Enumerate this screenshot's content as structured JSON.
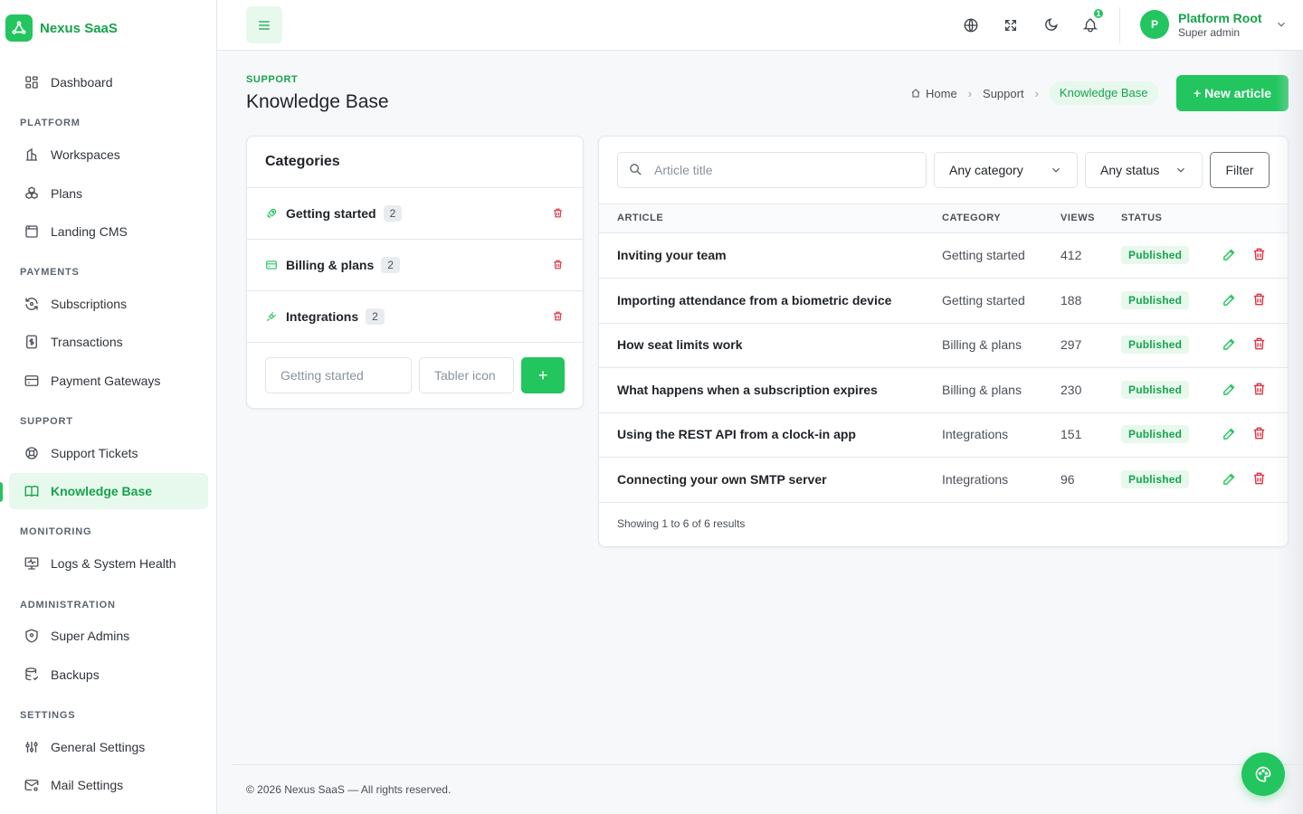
{
  "brand": {
    "name": "Nexus SaaS"
  },
  "sidebar": {
    "dashboard": "Dashboard",
    "sections": {
      "platform": "PLATFORM",
      "payments": "PAYMENTS",
      "support": "SUPPORT",
      "monitoring": "MONITORING",
      "administration": "ADMINISTRATION",
      "settings": "SETTINGS"
    },
    "items": {
      "workspaces": "Workspaces",
      "plans": "Plans",
      "landing_cms": "Landing CMS",
      "subscriptions": "Subscriptions",
      "transactions": "Transactions",
      "payment_gateways": "Payment Gateways",
      "support_tickets": "Support Tickets",
      "knowledge_base": "Knowledge Base",
      "logs": "Logs & System Health",
      "super_admins": "Super Admins",
      "backups": "Backups",
      "general_settings": "General Settings",
      "mail_settings": "Mail Settings"
    },
    "active": "knowledge_base"
  },
  "topbar": {
    "icons": [
      "menu-icon",
      "globe-icon",
      "fullscreen-icon",
      "moon-icon",
      "bell-icon"
    ],
    "notification_count": "1",
    "user": {
      "initial": "P",
      "name": "Platform Root",
      "role": "Super admin"
    }
  },
  "page": {
    "pretitle": "SUPPORT",
    "title": "Knowledge Base",
    "breadcrumb": {
      "home": "Home",
      "support": "Support",
      "current": "Knowledge Base"
    },
    "new_button": "+ New article"
  },
  "categories": {
    "title": "Categories",
    "items": [
      {
        "name": "Getting started",
        "count": "2",
        "icon": "rocket-icon"
      },
      {
        "name": "Billing & plans",
        "count": "2",
        "icon": "credit-card-icon"
      },
      {
        "name": "Integrations",
        "count": "2",
        "icon": "plug-icon"
      }
    ],
    "form": {
      "name_placeholder": "Getting started",
      "icon_placeholder": "Tabler icon",
      "add_label": "+"
    }
  },
  "articles": {
    "search_placeholder": "Article title",
    "category_filter": "Any category",
    "status_filter": "Any status",
    "filter_button": "Filter",
    "columns": {
      "article": "ARTICLE",
      "category": "CATEGORY",
      "views": "VIEWS",
      "status": "STATUS"
    },
    "rows": [
      {
        "title": "Inviting your team",
        "category": "Getting started",
        "views": "412",
        "status": "Published"
      },
      {
        "title": "Importing attendance from a biometric device",
        "category": "Getting started",
        "views": "188",
        "status": "Published"
      },
      {
        "title": "How seat limits work",
        "category": "Billing & plans",
        "views": "297",
        "status": "Published"
      },
      {
        "title": "What happens when a subscription expires",
        "category": "Billing & plans",
        "views": "230",
        "status": "Published"
      },
      {
        "title": "Using the REST API from a clock-in app",
        "category": "Integrations",
        "views": "151",
        "status": "Published"
      },
      {
        "title": "Connecting your own SMTP server",
        "category": "Integrations",
        "views": "96",
        "status": "Published"
      }
    ],
    "summary": "Showing 1 to 6 of 6 results"
  },
  "footer": {
    "text": "© 2026 Nexus SaaS — All rights reserved."
  },
  "colors": {
    "accent": "#22c55e",
    "accent_dark": "#16a34a",
    "accent_soft": "#e7f8ed",
    "danger": "#dc3545"
  }
}
